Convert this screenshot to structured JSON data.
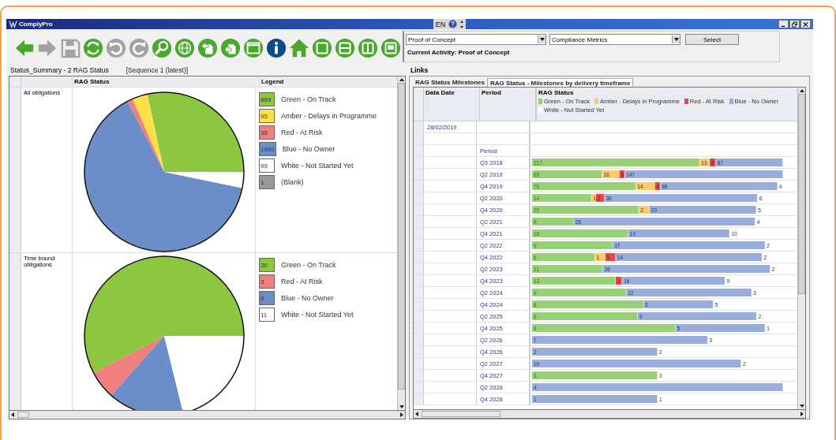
{
  "window": {
    "title": "ComplyPro",
    "language": "EN"
  },
  "toolbar": [
    {
      "kind": "back",
      "disabled": false
    },
    {
      "kind": "forward",
      "disabled": true
    },
    {
      "kind": "save",
      "disabled": true
    },
    {
      "kind": "refresh",
      "disabled": false
    },
    {
      "kind": "undo",
      "disabled": true
    },
    {
      "kind": "redo",
      "disabled": true
    },
    {
      "kind": "search",
      "disabled": false
    },
    {
      "kind": "globe",
      "disabled": false
    },
    {
      "kind": "doc-back",
      "disabled": false
    },
    {
      "kind": "doc-forward",
      "disabled": false
    },
    {
      "kind": "window",
      "disabled": false
    },
    {
      "kind": "info",
      "disabled": false
    },
    {
      "kind": "home",
      "disabled": false
    },
    {
      "kind": "layout-single",
      "disabled": false
    },
    {
      "kind": "layout-rows",
      "disabled": false
    },
    {
      "kind": "layout-columns",
      "disabled": false
    },
    {
      "kind": "monitor",
      "disabled": false
    }
  ],
  "selection": {
    "activity": "Proof of Concept",
    "report": "Compliance Metrics",
    "button": "Select",
    "current_label": "Current Activity:",
    "current_value": "Proof of Concept"
  },
  "status_summary": {
    "title": "Status_Summary - 2 RAG Status",
    "sequence": "[Sequence 1 (latest)]",
    "columns": [
      "RAG Status",
      "Legend"
    ],
    "rows": [
      {
        "label": "All obligations",
        "legend": [
          {
            "count": "869",
            "label": "Green - On Track",
            "color": "#8dc63f"
          },
          {
            "count": "95",
            "label": "Amber - Delays in Programme",
            "color": "#ffe04a"
          },
          {
            "count": "35",
            "label": "Red - At Risk",
            "color": "#f08080"
          },
          {
            "count": "1960",
            "label": "Blue - No Owner",
            "color": "#6b8ec9"
          },
          {
            "count": "99",
            "label": "White - Not Started Yet",
            "color": "#ffffff"
          },
          {
            "count": "1",
            "label": "(Blank)",
            "color": "#9a9a9a"
          }
        ]
      },
      {
        "label": "Time bound obligations",
        "legend": [
          {
            "count": "30",
            "label": "Green - On Track",
            "color": "#8dc63f"
          },
          {
            "count": "3",
            "label": "Red - At Risk",
            "color": "#f08080"
          },
          {
            "count": "8",
            "label": "Blue - No Owner",
            "color": "#6b8ec9"
          },
          {
            "count": "11",
            "label": "White - Not Started Yet",
            "color": "#ffffff"
          }
        ]
      }
    ]
  },
  "links": {
    "title": "Links",
    "tabs": [
      {
        "label": "RAG Status  Milestones",
        "selected": false
      },
      {
        "label": "RAG Status  - Milestones by delivery timeframe",
        "selected": true
      }
    ],
    "columns": [
      "Data Date",
      "Period",
      "RAG Status"
    ],
    "legend": [
      {
        "kind": "green",
        "label": "Green - On Track",
        "color": "#97d077"
      },
      {
        "kind": "amber",
        "label": "Amber - Delays in Programme",
        "color": "#ffc966"
      },
      {
        "kind": "red",
        "label": "Red - At Risk",
        "color": "#ee4444"
      },
      {
        "kind": "blue",
        "label": "Blue - No Owner",
        "color": "#9aaedc"
      },
      {
        "kind": "white",
        "label": "White - Not Started Yet",
        "color": "#ffffff"
      }
    ],
    "rows": [
      {
        "data_date": "28/02/2019"
      },
      {},
      {
        "period": "Period"
      },
      {
        "period": "Q3 2018",
        "segments": [
          {
            "kind": "green",
            "value": "217"
          },
          {
            "kind": "amber",
            "value": "13"
          },
          {
            "kind": "red",
            "value": "8"
          },
          {
            "kind": "blue",
            "value": "87"
          }
        ]
      },
      {
        "period": "Q2 2019",
        "segments": [
          {
            "kind": "green",
            "value": "65"
          },
          {
            "kind": "amber",
            "value": "16"
          },
          {
            "kind": "red",
            "value": "5"
          },
          {
            "kind": "blue",
            "value": "147"
          }
        ]
      },
      {
        "period": "Q4 2019",
        "segments": [
          {
            "kind": "green",
            "value": "76"
          },
          {
            "kind": "amber",
            "value": "14"
          },
          {
            "kind": "red",
            "value": "4"
          },
          {
            "kind": "blue",
            "value": "86"
          },
          {
            "kind": "white",
            "value": "4"
          }
        ]
      },
      {
        "period": "Q2 2020",
        "segments": [
          {
            "kind": "green",
            "value": "14"
          },
          {
            "kind": "amber",
            "value": "1"
          },
          {
            "kind": "red",
            "value": "2"
          },
          {
            "kind": "blue",
            "value": "36"
          },
          {
            "kind": "white",
            "value": "6"
          }
        ]
      },
      {
        "period": "Q4 2020",
        "segments": [
          {
            "kind": "green",
            "value": "20"
          },
          {
            "kind": "amber",
            "value": "2"
          },
          {
            "kind": "blue",
            "value": "20"
          },
          {
            "kind": "white",
            "value": "5"
          }
        ]
      },
      {
        "period": "Q2 2021",
        "segments": [
          {
            "kind": "green",
            "value": "6"
          },
          {
            "kind": "blue",
            "value": "26"
          },
          {
            "kind": "white",
            "value": "4"
          }
        ]
      },
      {
        "period": "Q4 2021",
        "segments": [
          {
            "kind": "green",
            "value": "18"
          },
          {
            "kind": "blue",
            "value": "19"
          },
          {
            "kind": "white",
            "value": "10"
          }
        ]
      },
      {
        "period": "Q2 2022",
        "segments": [
          {
            "kind": "green",
            "value": "9"
          },
          {
            "kind": "blue",
            "value": "17"
          },
          {
            "kind": "white",
            "value": "2"
          }
        ]
      },
      {
        "period": "Q4 2022",
        "segments": [
          {
            "kind": "green",
            "value": "6"
          },
          {
            "kind": "amber",
            "value": "1"
          },
          {
            "kind": "red",
            "value": "1"
          },
          {
            "kind": "blue",
            "value": "14"
          },
          {
            "kind": "white",
            "value": "2"
          }
        ]
      },
      {
        "period": "Q2 2023",
        "segments": [
          {
            "kind": "green",
            "value": "11"
          },
          {
            "kind": "blue",
            "value": "26"
          },
          {
            "kind": "white",
            "value": "2"
          }
        ]
      },
      {
        "period": "Q4 2023",
        "segments": [
          {
            "kind": "green",
            "value": "13"
          },
          {
            "kind": "red",
            "value": "1"
          },
          {
            "kind": "blue",
            "value": "16"
          },
          {
            "kind": "white",
            "value": "9"
          }
        ]
      },
      {
        "period": "Q2 2024",
        "segments": [
          {
            "kind": "green",
            "value": "9"
          },
          {
            "kind": "blue",
            "value": "12"
          },
          {
            "kind": "white",
            "value": "3"
          }
        ]
      },
      {
        "period": "Q4 2024",
        "segments": [
          {
            "kind": "green",
            "value": "8"
          },
          {
            "kind": "blue",
            "value": "5"
          },
          {
            "kind": "white",
            "value": "5"
          }
        ]
      },
      {
        "period": "Q2 2025",
        "segments": [
          {
            "kind": "green",
            "value": "8"
          },
          {
            "kind": "blue",
            "value": "9"
          },
          {
            "kind": "white",
            "value": "2"
          }
        ]
      },
      {
        "period": "Q4 2025",
        "segments": [
          {
            "kind": "green",
            "value": "8"
          },
          {
            "kind": "blue",
            "value": "5"
          },
          {
            "kind": "white",
            "value": "1"
          }
        ]
      },
      {
        "period": "Q2 2026",
        "segments": [
          {
            "kind": "blue",
            "value": "7"
          },
          {
            "kind": "white",
            "value": "3"
          }
        ]
      },
      {
        "period": "Q4 2026",
        "segments": [
          {
            "kind": "blue",
            "value": "2"
          },
          {
            "kind": "white",
            "value": "2"
          }
        ]
      },
      {
        "period": "Q2 2027",
        "segments": [
          {
            "kind": "blue",
            "value": "10"
          },
          {
            "kind": "white",
            "value": "2"
          }
        ]
      },
      {
        "period": "Q4 2027",
        "segments": [
          {
            "kind": "green",
            "value": "3"
          },
          {
            "kind": "white",
            "value": "3"
          }
        ]
      },
      {
        "period": "Q2 2028",
        "segments": [
          {
            "kind": "blue",
            "value": "4"
          }
        ]
      },
      {
        "period": "Q4 2028",
        "segments": [
          {
            "kind": "blue",
            "value": "1"
          },
          {
            "kind": "white",
            "value": "1"
          }
        ]
      }
    ]
  }
}
